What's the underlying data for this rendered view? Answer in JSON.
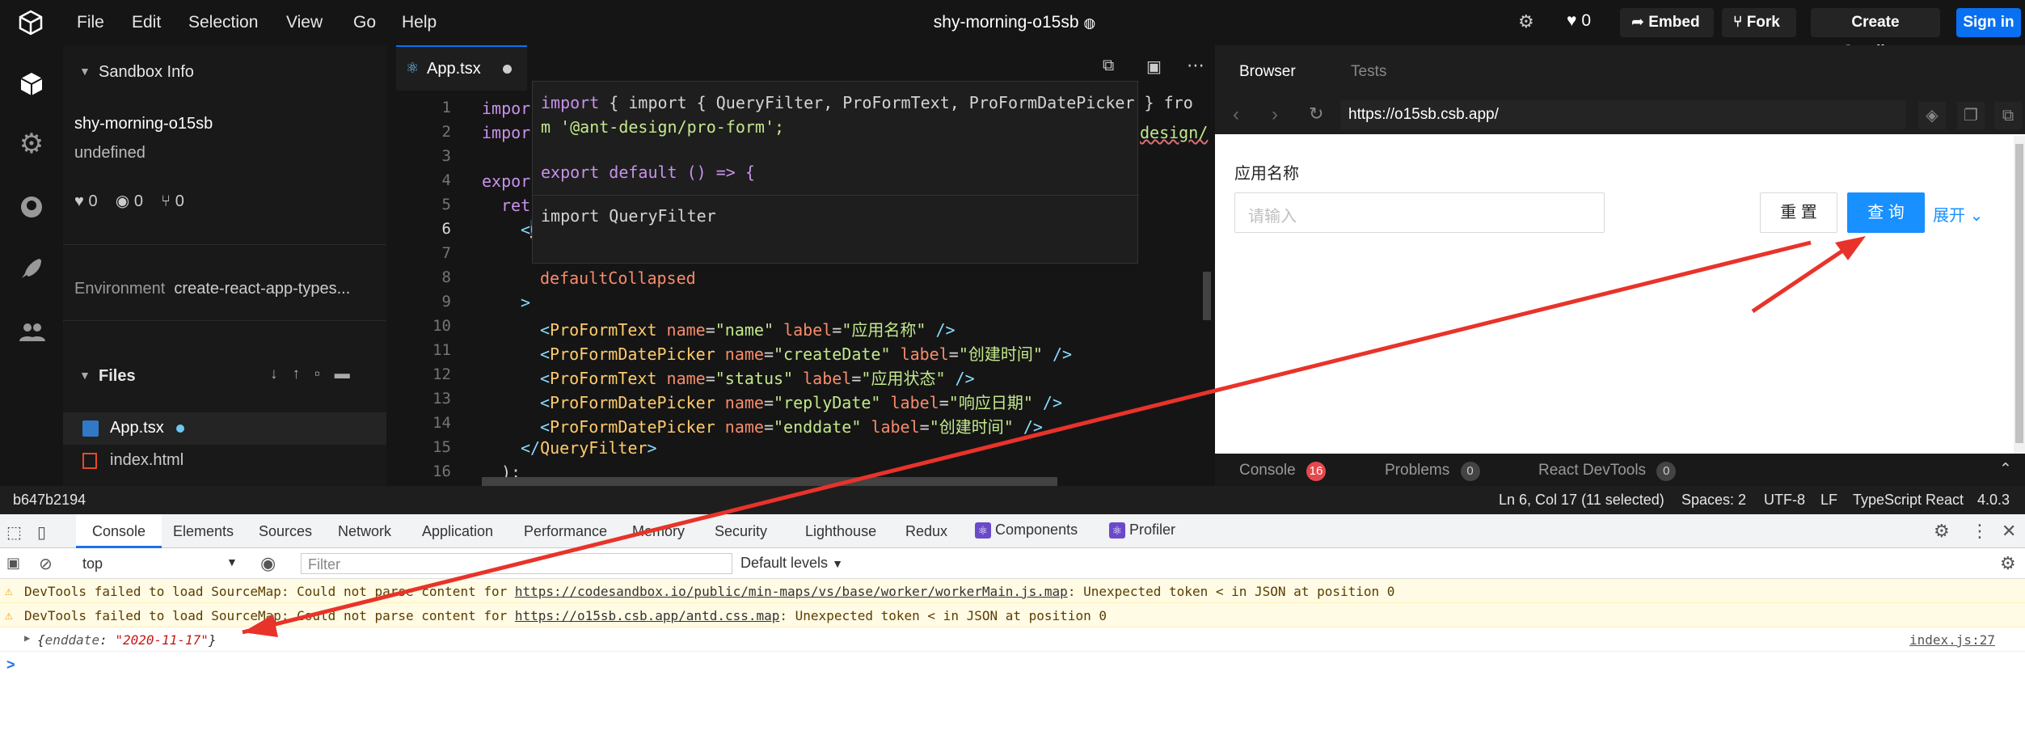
{
  "menu": {
    "file": "File",
    "edit": "Edit",
    "selection": "Selection",
    "view": "View",
    "go": "Go",
    "help": "Help"
  },
  "sandbox_name": "shy-morning-o15sb",
  "toolbar": {
    "likes": "0",
    "embed": "Embed",
    "fork": "Fork",
    "create": "Create Sandbox",
    "signin": "Sign in"
  },
  "sidebar": {
    "info_header": "Sandbox Info",
    "name": "shy-morning-o15sb",
    "description": "undefined",
    "likes": "0",
    "views": "0",
    "forks": "0",
    "environment_label": "Environment",
    "environment_value": "create-react-app-types...",
    "files_header": "Files",
    "files": [
      {
        "name": "App.tsx"
      },
      {
        "name": "index.html"
      }
    ]
  },
  "editor": {
    "tab": "App.tsx",
    "line_numbers": [
      "1",
      "2",
      "3",
      "4",
      "5",
      "6",
      "7",
      "8",
      "9",
      "10",
      "11",
      "12",
      "13",
      "14",
      "15",
      "16"
    ],
    "hover": {
      "line1a": "import { QueryFilter, ProFormText, ProFormDatePicker } fro",
      "line1b": "m '@ant-design/pro-form';",
      "line2": "export default () => {",
      "line3": "import QueryFilter"
    },
    "partial": {
      "l1": "impor",
      "l2": "impor",
      "l4": "expor",
      "l5": "ret",
      "side": "design/"
    }
  },
  "preview": {
    "tab_browser": "Browser",
    "tab_tests": "Tests",
    "url": "https://o15sb.csb.app/",
    "field_label": "应用名称",
    "placeholder": "请输入",
    "reset": "重 置",
    "query": "查 询",
    "expand": "展开",
    "console": "Console",
    "console_count": "16",
    "problems": "Problems",
    "problems_count": "0",
    "devtools": "React DevTools",
    "devtools_count": "0"
  },
  "status": {
    "hash": "b647b2194",
    "pos": "Ln 6, Col 17 (11 selected)",
    "spaces": "Spaces: 2",
    "enc": "UTF-8",
    "eol": "LF",
    "lang": "TypeScript React",
    "ver": "4.0.3"
  },
  "devtools": {
    "tabs": [
      "Console",
      "Elements",
      "Sources",
      "Network",
      "Application",
      "Performance",
      "Memory",
      "Security",
      "Lighthouse",
      "Redux",
      "Components",
      "Profiler"
    ],
    "context": "top",
    "filter_placeholder": "Filter",
    "levels": "Default levels",
    "warn1_pre": "DevTools failed to load SourceMap: Could not parse content for ",
    "warn1_link": "https://codesandbox.io/public/min-maps/vs/base/worker/workerMain.js.map",
    "warn1_post": ": Unexpected token < in JSON at position 0",
    "warn2_pre": "DevTools failed to load SourceMap: Could not parse content for ",
    "warn2_link": "https://o15sb.csb.app/antd.css.map",
    "warn2_post": ": Unexpected token < in JSON at position 0",
    "log_key": "enddate",
    "log_value": "\"2020-11-17\"",
    "log_source": "index.js:27",
    "prompt": ">"
  }
}
